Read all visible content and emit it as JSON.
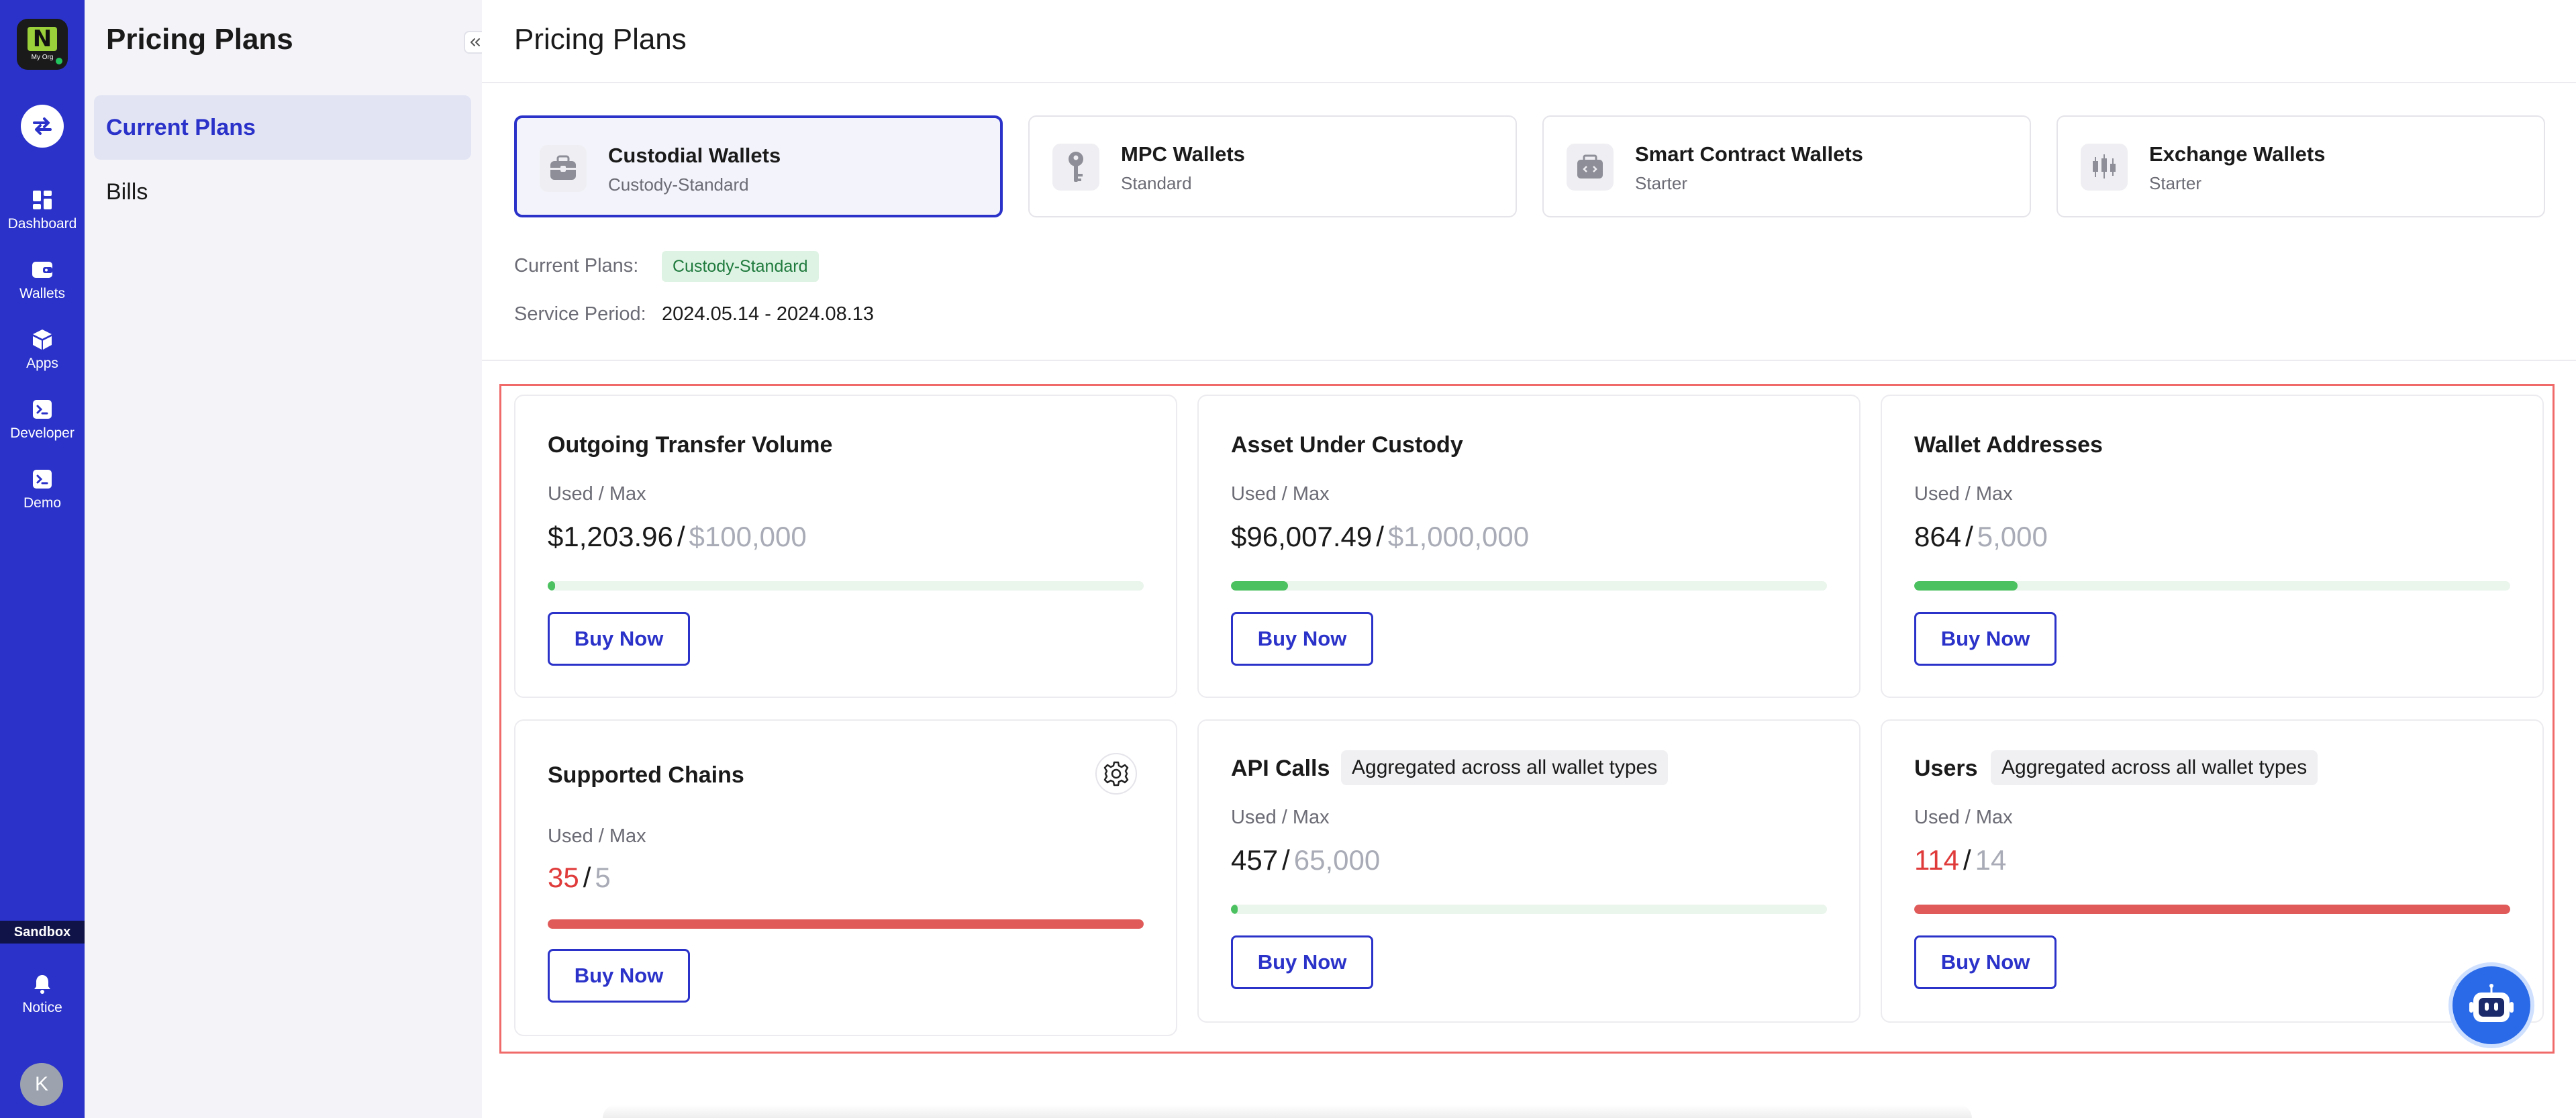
{
  "rail": {
    "org_logo_text": "My Org",
    "items": [
      {
        "label": "Dashboard",
        "icon": "grid-icon"
      },
      {
        "label": "Wallets",
        "icon": "wallet-icon"
      },
      {
        "label": "Apps",
        "icon": "cube-icon"
      },
      {
        "label": "Developer",
        "icon": "terminal-icon"
      },
      {
        "label": "Demo",
        "icon": "terminal-icon"
      }
    ],
    "environment": "Sandbox",
    "notice_label": "Notice",
    "avatar_initial": "K"
  },
  "sidebar": {
    "title": "Pricing Plans",
    "items": [
      {
        "label": "Current Plans",
        "active": true
      },
      {
        "label": "Bills",
        "active": false
      }
    ]
  },
  "main": {
    "title": "Pricing Plans",
    "wallet_types": [
      {
        "name": "Custodial Wallets",
        "plan": "Custody-Standard",
        "icon": "briefcase-icon",
        "active": true
      },
      {
        "name": "MPC Wallets",
        "plan": "Standard",
        "icon": "key-icon",
        "active": false
      },
      {
        "name": "Smart Contract Wallets",
        "plan": "Starter",
        "icon": "contract-icon",
        "active": false
      },
      {
        "name": "Exchange Wallets",
        "plan": "Starter",
        "icon": "candlestick-icon",
        "active": false
      }
    ],
    "current_plans_label": "Current Plans:",
    "current_plan_badge": "Custody-Standard",
    "service_period_label": "Service Period:",
    "service_period_value": "2024.05.14 - 2024.08.13",
    "used_max_label": "Used / Max",
    "buy_label": "Buy Now",
    "usage_cards": [
      {
        "title": "Outgoing Transfer Volume",
        "used": "$1,203.96",
        "max": "$100,000",
        "fraction": 0.012,
        "over": false
      },
      {
        "title": "Asset Under Custody",
        "used": "$96,007.49",
        "max": "$1,000,000",
        "fraction": 0.096,
        "over": false
      },
      {
        "title": "Wallet Addresses",
        "used": "864",
        "max": "5,000",
        "fraction": 0.173,
        "over": false
      },
      {
        "title": "Supported Chains",
        "used": "35",
        "max": "5",
        "fraction": 1.0,
        "over": true
      },
      {
        "title": "API Calls",
        "tag": "Aggregated across all wallet types",
        "used": "457",
        "max": "65,000",
        "fraction": 0.007,
        "over": false
      },
      {
        "title": "Users",
        "tag": "Aggregated across all wallet types",
        "used": "114",
        "max": "14",
        "fraction": 1.0,
        "over": true
      }
    ]
  },
  "colors": {
    "brand": "#2a32c9",
    "progress_ok": "#4cc160",
    "progress_over": "#e05a5a",
    "over_text": "#e03b3b",
    "highlight_border": "#f06a6a"
  }
}
